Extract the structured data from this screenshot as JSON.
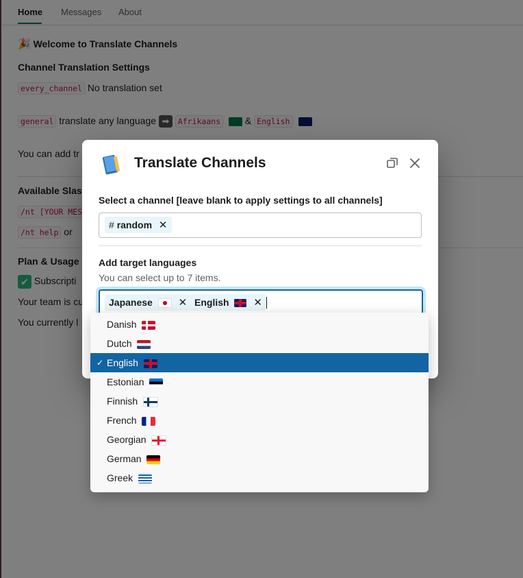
{
  "tabs": [
    "Home",
    "Messages",
    "About"
  ],
  "background": {
    "welcome": "Welcome to Translate Channels",
    "settings_heading": "Channel Translation Settings",
    "row1_code": "every_channel",
    "row1_text": "No translation set",
    "row2_code": "general",
    "row2_text": "translate any language",
    "row2_lang1": "Afrikaans",
    "row2_amp": "&",
    "row2_lang2": "English",
    "you_can_add": "You can add tr",
    "available_slash": "Available Slash",
    "cmd1": "/nt [YOUR MES",
    "cmd2": "/nt help",
    "cmd2_or": "or",
    "plan_usage": "Plan & Usage",
    "subscription": "Subscripti",
    "team_line": "Your team is cu",
    "currently_line": "You currently l"
  },
  "modal": {
    "title": "Translate Channels",
    "channel_label": "Select a channel [leave blank to apply settings to all channels]",
    "channel_chip": "random",
    "languages_label": "Add target languages",
    "languages_hint": "You can select up to 7 items.",
    "selected_languages": [
      "Japanese",
      "English"
    ]
  },
  "dropdown": {
    "options": [
      "Danish",
      "Dutch",
      "English",
      "Estonian",
      "Finnish",
      "French",
      "Georgian",
      "German",
      "Greek"
    ],
    "selected": "English",
    "check_mark": "✓"
  },
  "icons": {
    "close": "close-icon",
    "expand": "expand-icon",
    "hash": "#",
    "remove": "✕"
  }
}
